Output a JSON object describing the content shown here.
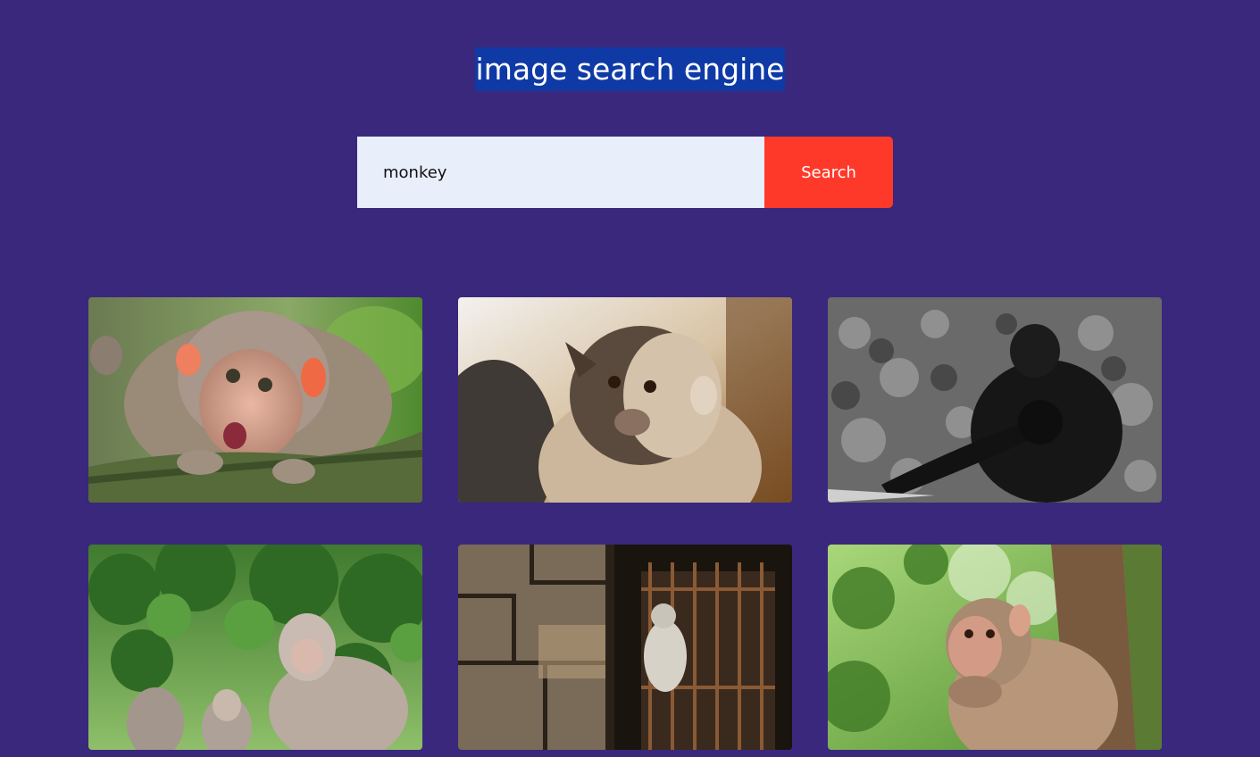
{
  "header": {
    "title": "image search engine"
  },
  "search": {
    "value": "monkey",
    "button_label": "Search"
  },
  "results": [
    {
      "name": "result-image-baby-macaque"
    },
    {
      "name": "result-image-macaque-portrait"
    },
    {
      "name": "result-image-bw-chimpanzees"
    },
    {
      "name": "result-image-macaque-group"
    },
    {
      "name": "result-image-monkey-window-bars"
    },
    {
      "name": "result-image-rhesus-eating"
    }
  ],
  "colors": {
    "background": "#39287c",
    "title_highlight": "#0f3aa6",
    "search_button": "#ff3929",
    "search_input_bg": "#e9eefb"
  }
}
